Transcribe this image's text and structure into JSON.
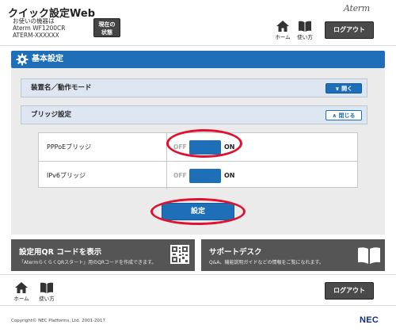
{
  "header": {
    "app_title": "クイック設定Web",
    "device_line1": "お使いの機器は",
    "device_line2": "Aterm WF1200CR",
    "device_line3": "ATERM-XXXXXX",
    "status_button_line1": "現在の",
    "status_button_line2": "状態",
    "brand_logo": "Aterm",
    "home_label": "ホーム",
    "help_label": "使い方",
    "logout_label": "ログアウト"
  },
  "section": {
    "title": "基本設定",
    "accordions": [
      {
        "label": "装置名／動作モード",
        "button_label": "開く"
      },
      {
        "label": "ブリッジ設定",
        "button_label": "閉じる"
      }
    ],
    "settings": [
      {
        "name": "PPPoEブリッジ",
        "off_label": "OFF",
        "on_label": "ON",
        "state": "ON"
      },
      {
        "name": "IPv6ブリッジ",
        "off_label": "OFF",
        "on_label": "ON",
        "state": "ON"
      }
    ],
    "save_label": "設定"
  },
  "tiles": {
    "qr": {
      "title": "設定用QR コードを表示",
      "desc": "「AtermらくらくQRスタート」用のQRコードを作成できます。"
    },
    "support": {
      "title": "サポートデスク",
      "desc": "Q&A、機能説明ガイドなどの情報をご覧になれます。"
    }
  },
  "footer": {
    "home_label": "ホーム",
    "help_label": "使い方",
    "logout_label": "ログアウト",
    "copyright": "Copyright© NEC Platforms, Ltd. 2001-2017",
    "nec_logo": "NEC"
  },
  "colors": {
    "accent": "#1e6fb8",
    "highlight": "#e2102f",
    "tile_bg": "#555555"
  }
}
